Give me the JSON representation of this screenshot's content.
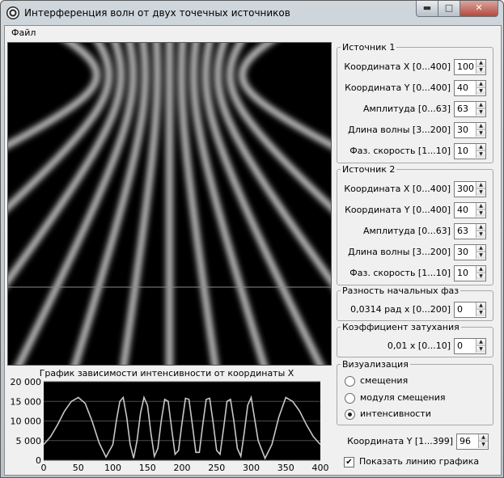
{
  "window": {
    "title": "Интерференция волн от двух точечных источников"
  },
  "window_buttons": {
    "minimize": "▬",
    "maximize": "□",
    "close": "✕"
  },
  "menu": {
    "file": "Файл"
  },
  "source1": {
    "legend": "Источник 1",
    "fields": [
      {
        "label": "Координата X [0...400]",
        "value": "100"
      },
      {
        "label": "Координата Y [0...400]",
        "value": "40"
      },
      {
        "label": "Амплитуда [0...63]",
        "value": "63"
      },
      {
        "label": "Длина волны [3...200]",
        "value": "30"
      },
      {
        "label": "Фаз. скорость [1...10]",
        "value": "10"
      }
    ]
  },
  "source2": {
    "legend": "Источник 2",
    "fields": [
      {
        "label": "Координата X [0...400]",
        "value": "300"
      },
      {
        "label": "Координата Y [0...400]",
        "value": "40"
      },
      {
        "label": "Амплитуда [0...63]",
        "value": "63"
      },
      {
        "label": "Длина волны [3...200]",
        "value": "30"
      },
      {
        "label": "Фаз. скорость [1...10]",
        "value": "10"
      }
    ]
  },
  "phase": {
    "legend": "Разность начальных фаз",
    "label": "0,0314 рад  x  [0...200]",
    "value": "0"
  },
  "damping": {
    "legend": "Коэффициент затухания",
    "label": "0,01  x  [0...10]",
    "value": "0"
  },
  "visual": {
    "legend": "Визуализация",
    "options": [
      "смещения",
      "модуля смещения",
      "интенсивности"
    ],
    "selected_index": 2
  },
  "coord_y": {
    "label": "Координата Y [1...399]",
    "value": "96"
  },
  "show_line": {
    "label": "Показать линию графика",
    "checked": true,
    "mark": "✔"
  },
  "spin_arrows": {
    "up": "▲",
    "down": "▼"
  },
  "colors": {
    "chart_bg": "#000000",
    "chart_line": "#c8c8c8",
    "fringe_line": "#8a8a8a"
  },
  "chart_data": {
    "type": "line",
    "title": "График зависимости интенсивности от координаты X",
    "xlim": [
      0,
      400
    ],
    "ylim": [
      0,
      20000
    ],
    "xticks": [
      0,
      50,
      100,
      150,
      200,
      250,
      300,
      350,
      400
    ],
    "yticks": [
      0,
      5000,
      10000,
      15000,
      20000
    ],
    "xtick_labels": [
      "0",
      "50",
      "100",
      "150",
      "200",
      "250",
      "300",
      "350",
      "400"
    ],
    "ytick_labels": [
      "0",
      "5 000",
      "10 000",
      "15 000",
      "20 000"
    ],
    "series": [
      {
        "x": [
          0,
          10,
          20,
          30,
          40,
          50,
          60,
          70,
          80,
          90,
          100,
          105,
          110,
          115,
          120,
          125,
          130,
          135,
          140,
          145,
          150,
          155,
          160,
          165,
          170,
          175,
          180,
          185,
          190,
          195,
          200,
          205,
          210,
          215,
          220,
          225,
          230,
          235,
          240,
          245,
          250,
          255,
          260,
          265,
          270,
          275,
          280,
          285,
          290,
          295,
          300,
          310,
          320,
          330,
          340,
          350,
          360,
          370,
          380,
          390,
          400
        ],
        "y": [
          4000,
          6000,
          9000,
          12500,
          15000,
          16000,
          14500,
          10000,
          4500,
          800,
          4000,
          10000,
          15000,
          16000,
          11000,
          4000,
          500,
          5000,
          12000,
          16000,
          14000,
          7000,
          1000,
          3000,
          10000,
          15500,
          15000,
          8000,
          1500,
          2500,
          9500,
          15800,
          15500,
          9000,
          2000,
          2000,
          9000,
          15500,
          15800,
          9500,
          2500,
          1500,
          8000,
          15000,
          15500,
          10000,
          3000,
          1000,
          7000,
          14000,
          16000,
          5000,
          500,
          4000,
          11000,
          16000,
          15000,
          12500,
          9000,
          6000,
          4000
        ]
      }
    ]
  }
}
